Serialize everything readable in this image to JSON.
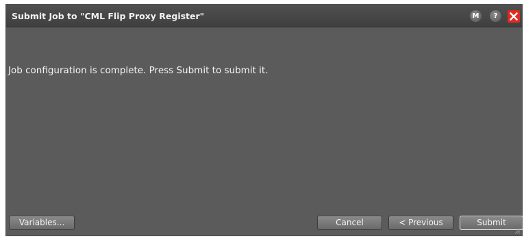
{
  "dialog": {
    "title": "Submit Job to \"CML Flip Proxy Register\"",
    "message": "Job configuration is complete.  Press Submit to submit it.",
    "titlebar_buttons": {
      "m_label": "M",
      "help_label": "?",
      "close_icon": "close-icon"
    }
  },
  "buttons": {
    "variables_label": "Variables...",
    "cancel_label": "Cancel",
    "previous_label": "< Previous",
    "submit_label": "Submit"
  },
  "colors": {
    "dialog_background": "#5b5b5b",
    "titlebar_background": "#474747",
    "close_button": "#e02a1f"
  }
}
